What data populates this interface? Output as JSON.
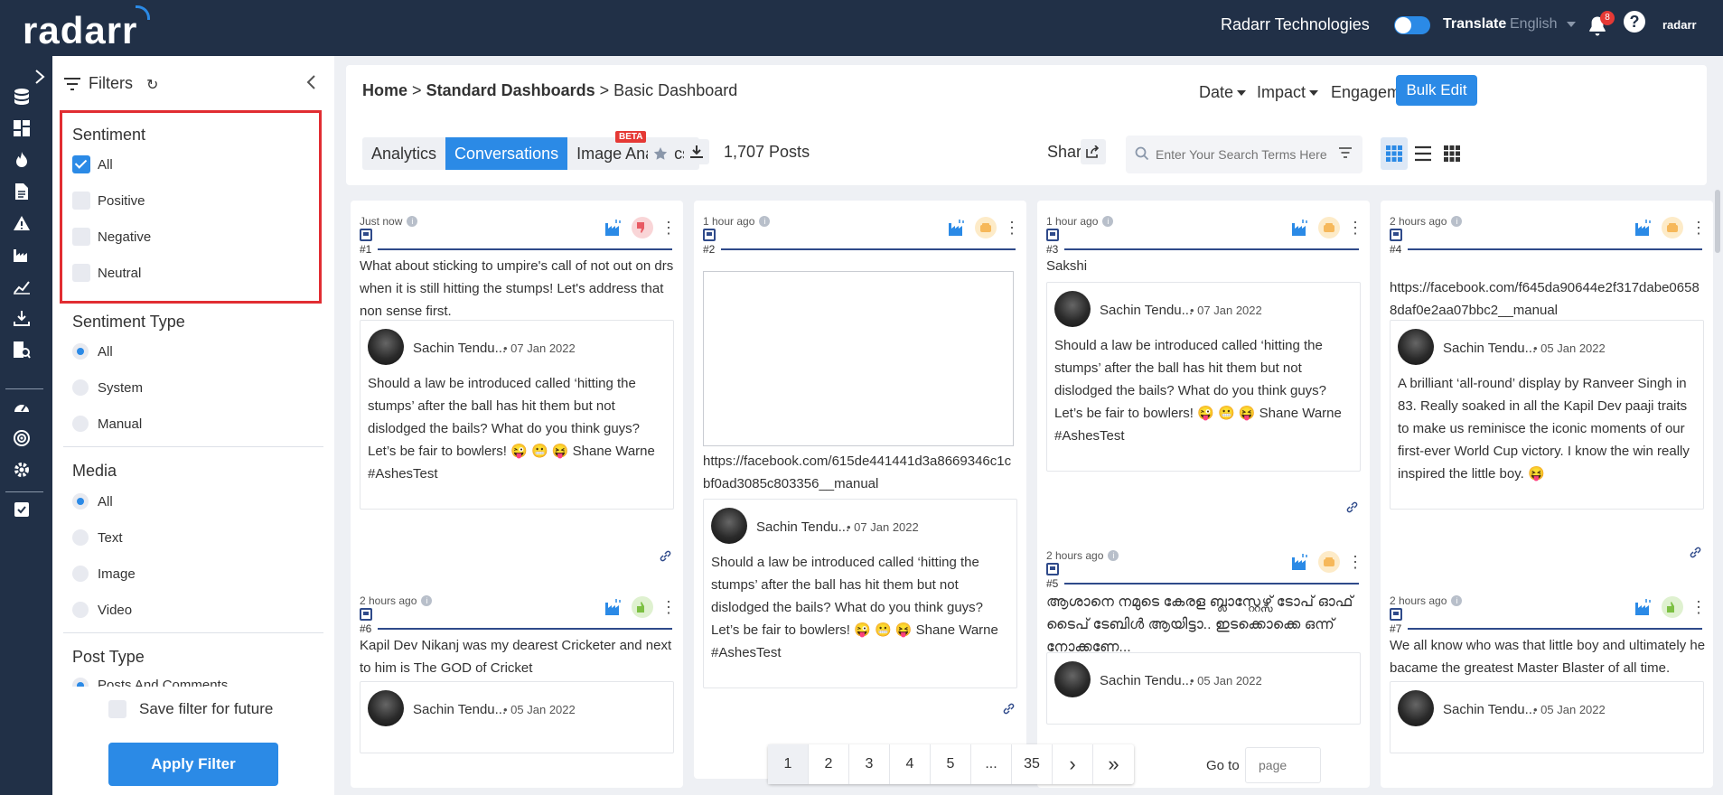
{
  "topbar": {
    "logo": "radarr",
    "company": "Radarr Technologies",
    "translate_label": "Translate",
    "language": "English",
    "notifications_count": "8",
    "help": "?",
    "mini_logo": "radarr"
  },
  "filters": {
    "title": "Filters",
    "sentiment": {
      "title": "Sentiment",
      "options": [
        "All",
        "Positive",
        "Negative",
        "Neutral"
      ],
      "selected": "All"
    },
    "sentiment_type": {
      "title": "Sentiment Type",
      "options": [
        "All",
        "System",
        "Manual"
      ],
      "selected": "All"
    },
    "media": {
      "title": "Media",
      "options": [
        "All",
        "Text",
        "Image",
        "Video"
      ],
      "selected": "All"
    },
    "post_type": {
      "title": "Post Type",
      "first_option": "Posts And Comments"
    },
    "save_label": "Save filter for future",
    "apply_label": "Apply Filter"
  },
  "header": {
    "breadcrumb": {
      "home": "Home",
      "sep": ">",
      "standard": "Standard Dashboards",
      "current": "Basic Dashboard"
    },
    "dropdowns": [
      "Date",
      "Impact",
      "Engagement"
    ],
    "bulk_edit": "Bulk Edit",
    "tabs": [
      "Analytics",
      "Conversations",
      "Image Analytics"
    ],
    "active_tab": "Conversations",
    "beta": "BETA",
    "posts_count": "1,707 Posts",
    "share": "Share",
    "search_placeholder": "Enter Your Search Terms Here"
  },
  "cards": [
    {
      "time": "Just now",
      "num": "#1",
      "sentiment": "negative",
      "text": "What about sticking to umpire's call of not out on drs when it is still hitting the stumps! Let's address that non sense first.",
      "author": "Sachin Tendu...",
      "date": "07 Jan 2022",
      "inner_text": "Should a law be introduced called ‘hitting the stumps’ after the ball has hit them but not dislodged the bails? What do you think guys? Let’s be fair to bowlers! 😜 😬 😝 Shane Warne #AshesTest"
    },
    {
      "time": "1 hour ago",
      "num": "#2",
      "sentiment": "neutral",
      "text": "https://facebook.com/615de441441d3a8669346c1cbf0ad3085c803356__manual",
      "author": "Sachin Tendu...",
      "date": "07 Jan 2022",
      "inner_text": "Should a law be introduced called ‘hitting the stumps’ after the ball has hit them but not dislodged the bails? What do you think guys? Let’s be fair to bowlers! 😜 😬 😝 Shane Warne #AshesTest"
    },
    {
      "time": "1 hour ago",
      "num": "#3",
      "sentiment": "neutral",
      "text": "Sakshi",
      "author": "Sachin Tendu...",
      "date": "07 Jan 2022",
      "inner_text": "Should a law be introduced called ‘hitting the stumps’ after the ball has hit them but not dislodged the bails? What do you think guys? Let’s be fair to bowlers! 😜 😬 😝 Shane Warne #AshesTest"
    },
    {
      "time": "2 hours ago",
      "num": "#4",
      "sentiment": "neutral",
      "text": "https://facebook.com/f645da90644e2f317dabe06588daf0e2aa07bbc2__manual",
      "author": "Sachin Tendu...",
      "date": "05 Jan 2022",
      "inner_text": "A brilliant ‘all-round’ display by Ranveer Singh in 83. Really soaked in all the Kapil Dev paaji traits to make us reminisce the iconic moments of our first-ever World Cup victory. I know the win really inspired the little boy. 😝"
    },
    {
      "time": "2 hours ago",
      "num": "#5",
      "sentiment": "neutral",
      "text": "ആശാനെ നമുടെ കേരള ബ്ലാസ്റ്റേഴ്സ് ടോപ് ഓഫ് ടൈപ് ടേബിൾ ആയിട്ടാ.. ഇടക്കൊക്കെ ഒന്ന് നോക്കണേ...",
      "author": "Sachin Tendu...",
      "date": "05 Jan 2022"
    },
    {
      "time": "2 hours ago",
      "num": "#6",
      "sentiment": "positive",
      "text": "Kapil Dev Nikanj was my dearest Cricketer and next to him is The GOD of Cricket",
      "author": "Sachin Tendu...",
      "date": "05 Jan 2022"
    },
    {
      "time": "2 hours ago",
      "num": "#7",
      "sentiment": "positive",
      "text": "We all know who was that little boy and ultimately he bacame the greatest Master Blaster of all time.",
      "author": "Sachin Tendu...",
      "date": "05 Jan 2022"
    }
  ],
  "pagination": {
    "pages": [
      "1",
      "2",
      "3",
      "4",
      "5",
      "...",
      "35"
    ],
    "next": "›",
    "last": "»",
    "goto_label": "Go to",
    "goto_placeholder": "page"
  },
  "colors": {
    "accent": "#2b8ae6",
    "topbar": "#213047",
    "highlight_border": "#e12d32",
    "negative": "#e85a63",
    "positive": "#7cc042",
    "neutral": "#f6b85a"
  }
}
